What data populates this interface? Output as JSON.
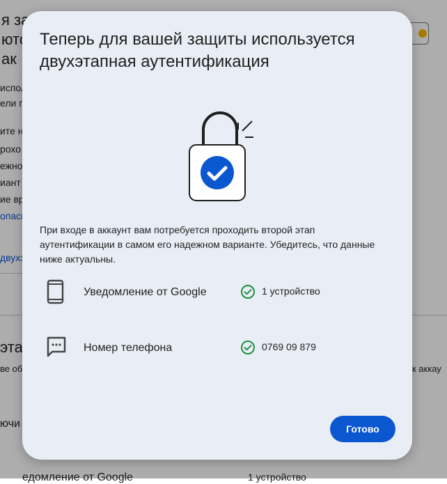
{
  "background": {
    "lines": [
      "я защ",
      "ются",
      "ак",
      "исполн",
      "ели по",
      "ите не",
      "рохо",
      "ежном",
      "иант",
      "ие вре",
      "опасн",
      "двухэ",
      "этап",
      "ве обн",
      "к аккау",
      "ючи",
      "едомление от Google",
      "1 устройство"
    ]
  },
  "dialog": {
    "title": "Теперь для вашей защиты используется двухэтапная аутентификация",
    "description": "При входе в аккаунт вам потребуется проходить второй этап аутентификации в самом его надежном варианте. Убедитесь, что данные ниже актуальны.",
    "methods": [
      {
        "icon": "phone-icon",
        "label": "Уведомление от Google",
        "value": "1 устройство"
      },
      {
        "icon": "message-icon",
        "label": "Номер телефона",
        "value": "0769 09 879"
      }
    ],
    "done_label": "Готово"
  },
  "colors": {
    "accent": "#0b57d0",
    "success": "#1e8e3e",
    "dialog_bg": "#e9eef6"
  }
}
